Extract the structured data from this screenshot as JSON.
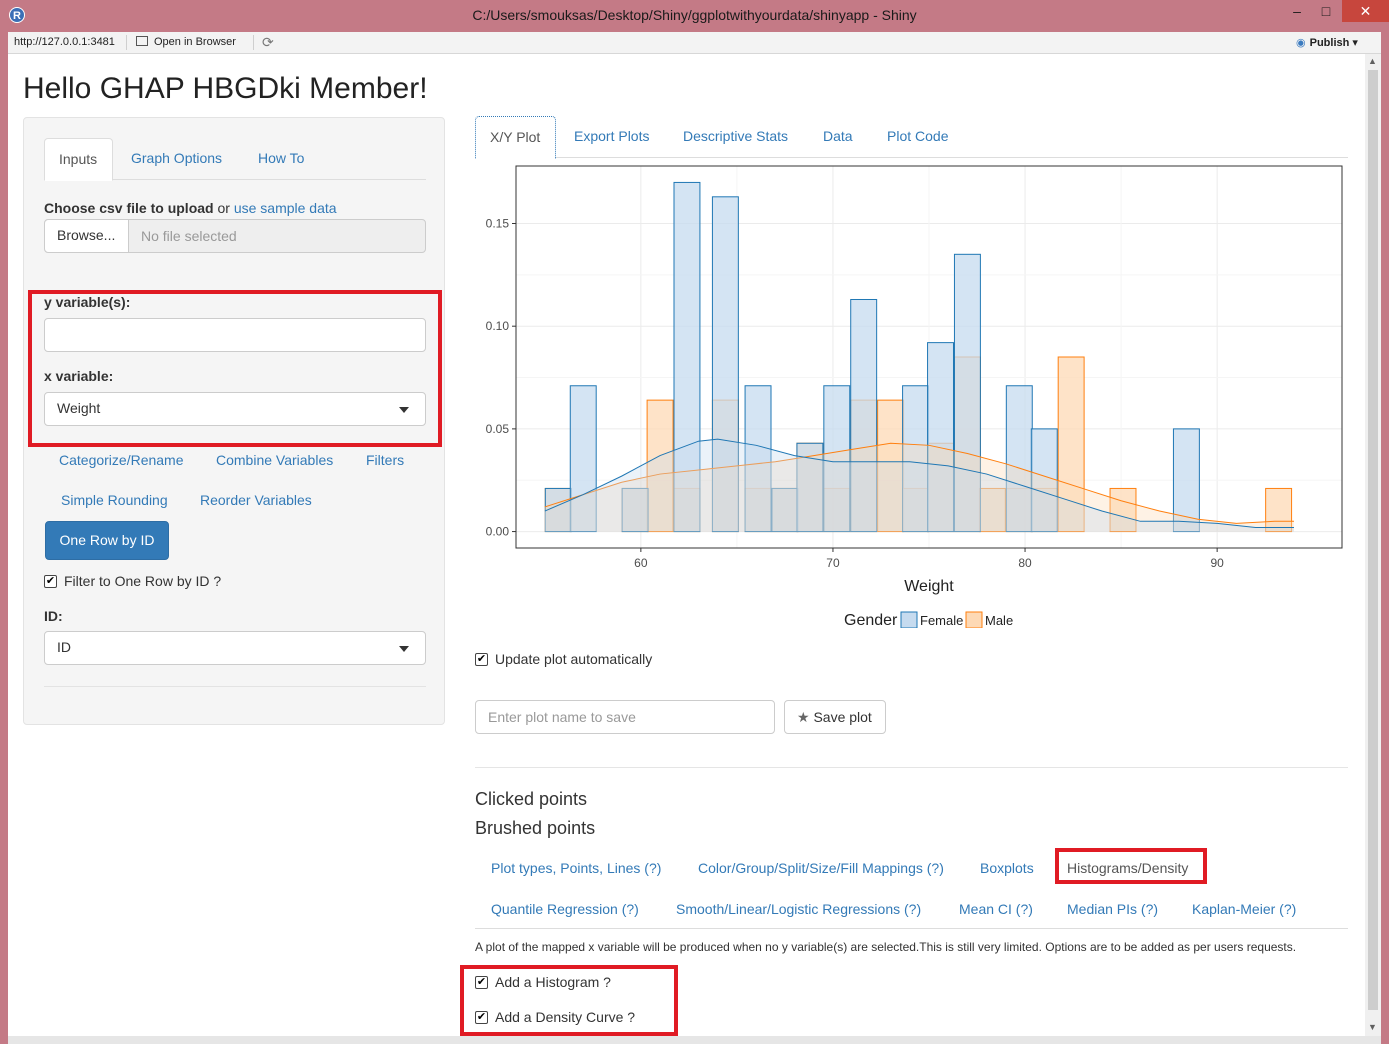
{
  "window": {
    "title": "C:/Users/smouksas/Desktop/Shiny/ggplotwithyourdata/shinyapp - Shiny",
    "app_icon_letter": "R",
    "minimize": "–",
    "maximize": "□",
    "close": "✕"
  },
  "toolbar": {
    "url": "http://127.0.0.1:3481",
    "open_in_browser": "Open in Browser",
    "publish": "Publish"
  },
  "page": {
    "title": "Hello GHAP HBGDki Member!"
  },
  "sidebar": {
    "tabs": [
      {
        "label": "Inputs",
        "active": true
      },
      {
        "label": "Graph Options",
        "active": false
      },
      {
        "label": "How To",
        "active": false
      }
    ],
    "file_label_bold": "Choose csv file to upload",
    "file_label_or": " or ",
    "file_label_link": "use sample data",
    "browse_button": "Browse...",
    "file_placeholder": "No file selected",
    "y_label": "y variable(s):",
    "y_value": "",
    "x_label": "x variable:",
    "x_value": "Weight",
    "links": [
      "Categorize/Rename",
      "Combine Variables",
      "Filters",
      "Simple Rounding",
      "Reorder Variables"
    ],
    "one_row_button": "One Row by ID",
    "filter_checkbox": {
      "label": "Filter to One Row by ID ?",
      "checked": true
    },
    "id_label": "ID:",
    "id_value": "ID"
  },
  "main_tabs": [
    {
      "label": "X/Y Plot",
      "active": true
    },
    {
      "label": "Export Plots",
      "active": false
    },
    {
      "label": "Descriptive Stats",
      "active": false
    },
    {
      "label": "Data",
      "active": false
    },
    {
      "label": "Plot Code",
      "active": false
    }
  ],
  "update_checkbox": {
    "label": "Update plot automatically",
    "checked": true
  },
  "plot_name_placeholder": "Enter plot name to save",
  "save_plot_button": "Save plot",
  "clicked_points": "Clicked points",
  "brushed_points": "Brushed points",
  "graph_option_tabs": [
    {
      "label": "Plot types, Points, Lines (?)",
      "active": false
    },
    {
      "label": "Color/Group/Split/Size/Fill Mappings (?)",
      "active": false
    },
    {
      "label": "Boxplots",
      "active": false
    },
    {
      "label": "Histograms/Density",
      "active": true
    },
    {
      "label": "Quantile Regression (?)",
      "active": false
    },
    {
      "label": "Smooth/Linear/Logistic Regressions (?)",
      "active": false
    },
    {
      "label": "Mean CI (?)",
      "active": false
    },
    {
      "label": "Median PIs (?)",
      "active": false
    },
    {
      "label": "Kaplan-Meier (?)",
      "active": false
    }
  ],
  "histogram_note": "A plot of the mapped x variable will be produced when no y variable(s) are selected.This is still very limited. Options are to be added as per users requests.",
  "options": [
    {
      "label": "Add a Histogram ?",
      "checked": true
    },
    {
      "label": "Add a Density Curve ?",
      "checked": true
    }
  ],
  "colors": {
    "female_fill": "#c6dbef",
    "female_line": "#1f77b4",
    "male_fill": "#fdd9b5",
    "male_line": "#ff7f0e",
    "highlight": "#e01b24",
    "link": "#337ab7"
  },
  "chart_data": {
    "type": "histogram",
    "xlabel": "Weight",
    "ylabel": "",
    "xlim": [
      53.5,
      96.5
    ],
    "ylim": [
      -0.008,
      0.178
    ],
    "x_ticks": [
      60,
      70,
      80,
      90
    ],
    "y_ticks": [
      0.0,
      0.05,
      0.1,
      0.15
    ],
    "y_tick_labels": [
      "0.00",
      "0.05",
      "0.10",
      "0.15"
    ],
    "bin_width": 1.35,
    "legend_title": "Gender",
    "legend_position": "bottom",
    "grid": true,
    "series": [
      {
        "name": "Female",
        "bins": [
          {
            "x": 55.7,
            "density": 0.021
          },
          {
            "x": 57.0,
            "density": 0.071
          },
          {
            "x": 59.7,
            "density": 0.021
          },
          {
            "x": 62.4,
            "density": 0.17
          },
          {
            "x": 64.4,
            "density": 0.163
          },
          {
            "x": 66.1,
            "density": 0.071
          },
          {
            "x": 67.5,
            "density": 0.021
          },
          {
            "x": 68.8,
            "density": 0.043
          },
          {
            "x": 70.2,
            "density": 0.071
          },
          {
            "x": 71.6,
            "density": 0.113
          },
          {
            "x": 74.3,
            "density": 0.071
          },
          {
            "x": 75.6,
            "density": 0.092
          },
          {
            "x": 77.0,
            "density": 0.135
          },
          {
            "x": 79.7,
            "density": 0.071
          },
          {
            "x": 81.0,
            "density": 0.05
          },
          {
            "x": 88.4,
            "density": 0.05
          }
        ],
        "density_curve": [
          [
            55,
            0.01
          ],
          [
            57,
            0.018
          ],
          [
            59,
            0.027
          ],
          [
            61,
            0.037
          ],
          [
            63,
            0.044
          ],
          [
            64,
            0.045
          ],
          [
            66,
            0.042
          ],
          [
            68,
            0.037
          ],
          [
            70,
            0.034
          ],
          [
            72,
            0.034
          ],
          [
            74,
            0.034
          ],
          [
            76,
            0.032
          ],
          [
            78,
            0.028
          ],
          [
            80,
            0.022
          ],
          [
            82,
            0.016
          ],
          [
            84,
            0.01
          ],
          [
            86,
            0.005
          ],
          [
            88,
            0.005
          ],
          [
            90,
            0.004
          ],
          [
            92,
            0.002
          ],
          [
            94,
            0.002
          ]
        ]
      },
      {
        "name": "Male",
        "bins": [
          {
            "x": 55.7,
            "density": 0.021
          },
          {
            "x": 59.7,
            "density": 0.021
          },
          {
            "x": 61.0,
            "density": 0.064
          },
          {
            "x": 62.4,
            "density": 0.021
          },
          {
            "x": 64.4,
            "density": 0.064
          },
          {
            "x": 66.1,
            "density": 0.021
          },
          {
            "x": 67.5,
            "density": 0.021
          },
          {
            "x": 68.8,
            "density": 0.043
          },
          {
            "x": 70.2,
            "density": 0.021
          },
          {
            "x": 71.6,
            "density": 0.064
          },
          {
            "x": 73.0,
            "density": 0.064
          },
          {
            "x": 74.3,
            "density": 0.021
          },
          {
            "x": 75.6,
            "density": 0.043
          },
          {
            "x": 77.0,
            "density": 0.085
          },
          {
            "x": 78.3,
            "density": 0.021
          },
          {
            "x": 79.7,
            "density": 0.021
          },
          {
            "x": 81.0,
            "density": 0.021
          },
          {
            "x": 82.4,
            "density": 0.085
          },
          {
            "x": 85.1,
            "density": 0.021
          },
          {
            "x": 93.2,
            "density": 0.021
          }
        ],
        "density_curve": [
          [
            55,
            0.012
          ],
          [
            57,
            0.018
          ],
          [
            59,
            0.024
          ],
          [
            61,
            0.028
          ],
          [
            63,
            0.03
          ],
          [
            65,
            0.032
          ],
          [
            67,
            0.034
          ],
          [
            69,
            0.037
          ],
          [
            71,
            0.04
          ],
          [
            73,
            0.043
          ],
          [
            75,
            0.042
          ],
          [
            77,
            0.038
          ],
          [
            79,
            0.033
          ],
          [
            81,
            0.027
          ],
          [
            83,
            0.021
          ],
          [
            85,
            0.015
          ],
          [
            87,
            0.01
          ],
          [
            89,
            0.006
          ],
          [
            91,
            0.004
          ],
          [
            93,
            0.005
          ],
          [
            94,
            0.005
          ]
        ]
      }
    ]
  }
}
